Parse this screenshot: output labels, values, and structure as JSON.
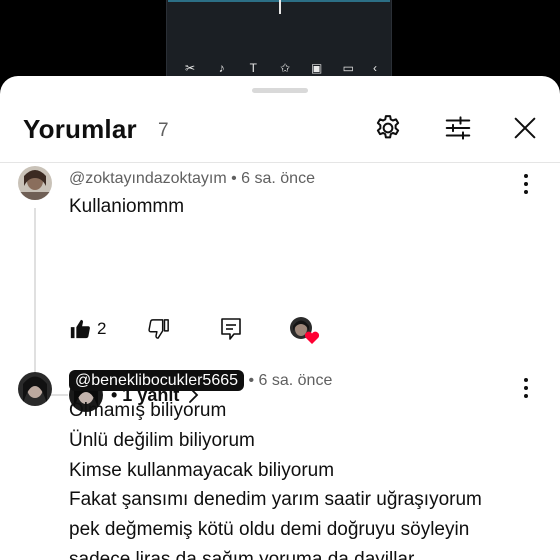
{
  "editor": {
    "toolbar_icons": [
      "scissors-icon",
      "music-note-icon",
      "text-icon",
      "sticker-icon",
      "overlay-icon",
      "caption-icon",
      "more-icon"
    ]
  },
  "sheet": {
    "title": "Yorumlar",
    "count": "7"
  },
  "comments": [
    {
      "handle": "@zoktayındazoktayım",
      "separator": " • ",
      "time": "6 sa. önce",
      "text": "Kullaniommm",
      "likes": "2",
      "reply_label": "• 1 yanıt"
    },
    {
      "handle": "@beneklibocukler5665",
      "separator": " • ",
      "time": "6 sa. önce",
      "lines": [
        "Olmamış biliyorum",
        "Ünlü değilim biliyorum",
        "Kimse kullanmayacak biliyorum",
        "Fakat şansımı denedim yarım saatir uğraşıyorum",
        "pek değmemiş kötü oldu demi doğruyu söyleyin",
        "sadece liras da sağım yoruma da dayillar"
      ]
    }
  ],
  "colors": {
    "sheet_bg": "#ffffff",
    "text_primary": "#0f0f0f",
    "text_secondary": "#606060",
    "heart": "#ff0033"
  }
}
